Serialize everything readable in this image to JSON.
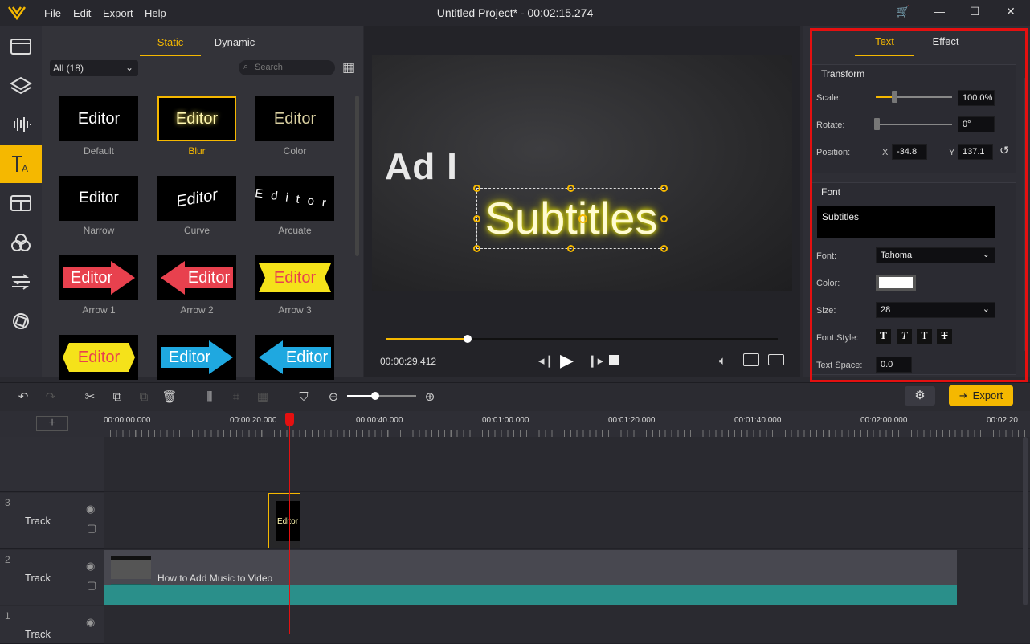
{
  "app": {
    "title": "Untitled Project* - 00:02:15.274",
    "menu": [
      "File",
      "Edit",
      "Export",
      "Help"
    ]
  },
  "library": {
    "tabs": [
      "Static",
      "Dynamic"
    ],
    "active_tab": "Static",
    "filter": "All (18)",
    "search_placeholder": "Search",
    "tiles": [
      {
        "text": "Editor",
        "label": "Default"
      },
      {
        "text": "Editor",
        "label": "Blur"
      },
      {
        "text": "Editor",
        "label": "Color"
      },
      {
        "text": "Editor",
        "label": "Narrow"
      },
      {
        "text": "Editor",
        "label": "Curve"
      },
      {
        "text": "Editor",
        "label": "Arcuate"
      },
      {
        "text": "Editor",
        "label": "Arrow 1"
      },
      {
        "text": "Editor",
        "label": "Arrow 2"
      },
      {
        "text": "Editor",
        "label": "Arrow 3"
      },
      {
        "text": "Editor",
        "label": ""
      },
      {
        "text": "Editor",
        "label": ""
      },
      {
        "text": "Editor",
        "label": ""
      }
    ]
  },
  "preview": {
    "overlay_text": "Ad I",
    "subtitle": "Subtitles",
    "time": "00:00:29.412",
    "progress": 0.21
  },
  "panel": {
    "tabs": [
      "Text",
      "Effect"
    ],
    "active_tab": "Text",
    "transform": {
      "heading": "Transform",
      "scale_label": "Scale:",
      "scale": "100.0%",
      "rotate_label": "Rotate:",
      "rotate": "0°",
      "position_label": "Position:",
      "x_label": "X",
      "x": "-34.8",
      "y_label": "Y",
      "y": "137.1"
    },
    "font": {
      "heading": "Font",
      "text": "Subtitles",
      "font_label": "Font:",
      "font": "Tahoma",
      "color_label": "Color:",
      "size_label": "Size:",
      "size": "28",
      "style_label": "Font Style:",
      "space_label": "Text Space:",
      "space": "0.0"
    }
  },
  "toolbar": {
    "export": "Export"
  },
  "ruler": [
    "00:00:00.000",
    "00:00:20.000",
    "00:00:40.000",
    "00:01:00.000",
    "00:01:20.000",
    "00:01:40.000",
    "00:02:00.000",
    "00:02:20"
  ],
  "tracks": [
    {
      "num": "3",
      "name": "Track",
      "clip": "Editor"
    },
    {
      "num": "2",
      "name": "Track",
      "clip": "How to Add Music to Video"
    },
    {
      "num": "1",
      "name": "Track"
    }
  ],
  "colors": {
    "accent": "#f5b800",
    "highlight": "#e41010",
    "audio": "#2a8f8a"
  }
}
